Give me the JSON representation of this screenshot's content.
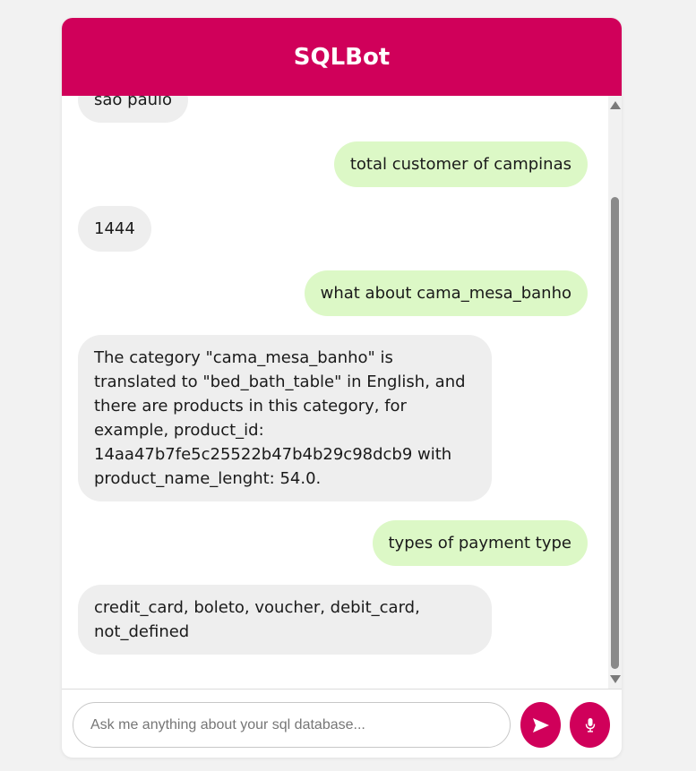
{
  "header": {
    "title": "SQLBot"
  },
  "messages": [
    {
      "sender": "bot",
      "text": "sao paulo"
    },
    {
      "sender": "user",
      "text": "total customer of campinas"
    },
    {
      "sender": "bot",
      "text": "1444"
    },
    {
      "sender": "user",
      "text": "what about cama_mesa_banho"
    },
    {
      "sender": "bot",
      "text": "The category \"cama_mesa_banho\" is translated to \"bed_bath_table\" in English, and there are products in this category, for example, product_id: 14aa47b7fe5c25522b47b4b29c98dcb9 with product_name_lenght: 54.0."
    },
    {
      "sender": "user",
      "text": "types of payment type"
    },
    {
      "sender": "bot",
      "text": "credit_card, boleto, voucher, debit_card, not_defined"
    }
  ],
  "input": {
    "value": "",
    "placeholder": "Ask me anything about your sql database..."
  },
  "buttons": {
    "send_icon": "send-icon",
    "mic_icon": "microphone-icon"
  },
  "colors": {
    "accent": "#d0005a",
    "user_bubble": "#dcf8c6",
    "bot_bubble": "#eeeeee",
    "page_background": "#f2f2f2"
  }
}
